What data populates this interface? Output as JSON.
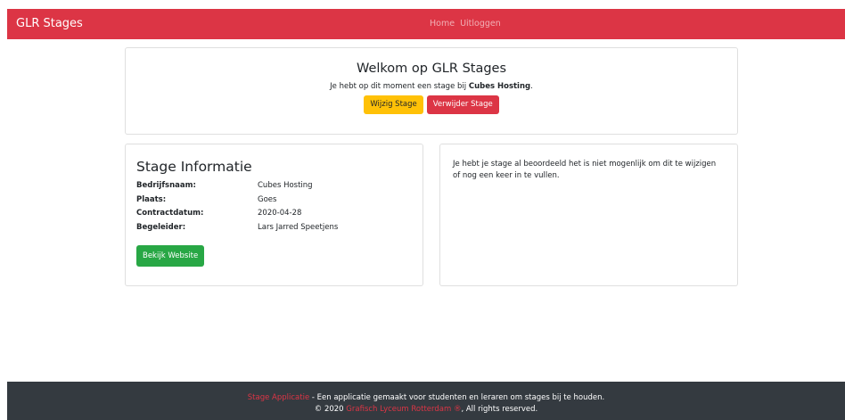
{
  "navbar": {
    "brand": "GLR Stages",
    "links": [
      {
        "label": "Home"
      },
      {
        "label": "Uitloggen"
      }
    ],
    "color": "#dc3545"
  },
  "welcome": {
    "title": "Welkom op GLR Stages",
    "text_prefix": "Je hebt op dit moment een stage bij ",
    "company": "Cubes Hosting",
    "text_suffix": ".",
    "edit_button": "Wijzig Stage",
    "delete_button": "Verwijder Stage"
  },
  "stage_info": {
    "title": "Stage Informatie",
    "rows": [
      {
        "key": "Bedrijfsnaam:",
        "value": "Cubes Hosting"
      },
      {
        "key": "Plaats:",
        "value": "Goes"
      },
      {
        "key": "Contractdatum:",
        "value": "2020-04-28"
      },
      {
        "key": "Begeleider:",
        "value": "Lars Jarred Speetjens"
      }
    ],
    "website_button": "Bekijk Website"
  },
  "note": {
    "text": "Je hebt je stage al beoordeeld het is niet mogenlijk om dit te wijzigen of nog een keer in te vullen."
  },
  "footer": {
    "app_link": "Stage Applicatie",
    "line1_rest": " - Een applicatie gemaakt voor studenten en leraren om stages bij te houden.",
    "copy_prefix": "© 2020 ",
    "school_link": "Grafisch Lyceum Rotterdam ®",
    "copy_suffix": ", All rights reserved."
  }
}
